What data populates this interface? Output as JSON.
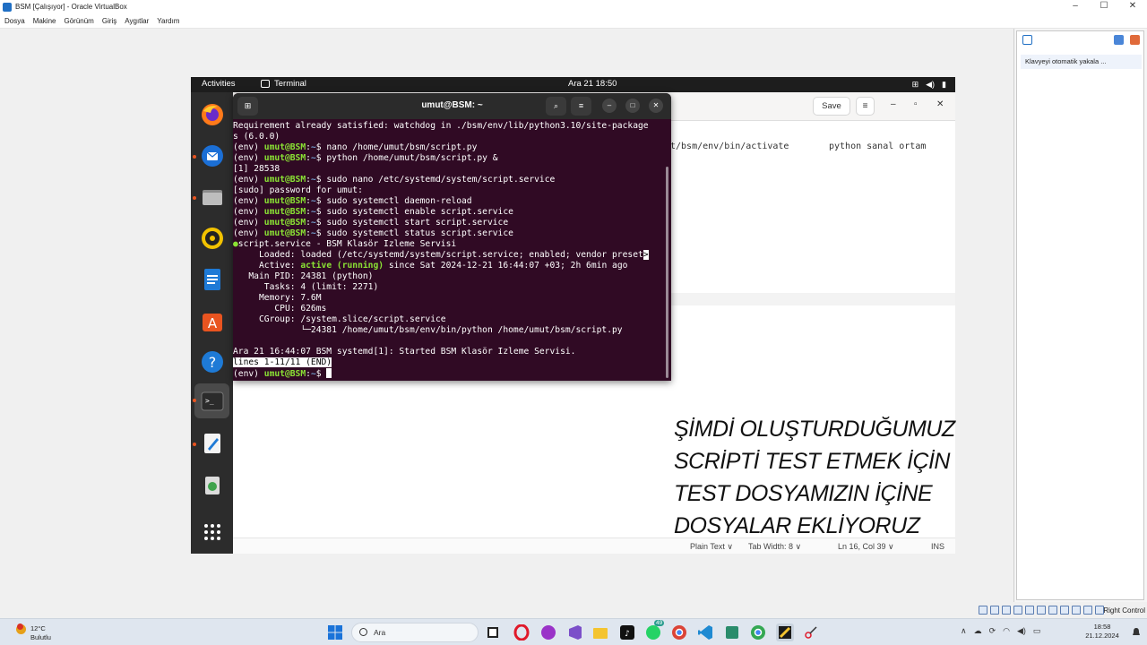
{
  "vbox": {
    "title": "BSM [Çalışıyor] - Oracle VirtualBox",
    "menu": [
      "Dosya",
      "Makine",
      "Görünüm",
      "Giriş",
      "Aygıtlar",
      "Yardım"
    ],
    "controls": {
      "minimize": "–",
      "maximize": "☐",
      "close": "✕"
    },
    "side_notice": "Klavyeyi otomatik yakala ...",
    "status_right": "Right Control"
  },
  "gnome": {
    "activities": "Activities",
    "app": "Terminal",
    "clock": "Ara 21  18:50",
    "tray": [
      "⊞",
      "◀)",
      "▮"
    ]
  },
  "dock": {
    "items": [
      "firefox-icon",
      "thunderbird-icon",
      "files-icon",
      "rhythmbox-icon",
      "writer-icon",
      "software-icon",
      "help-icon",
      "terminal-icon",
      "text-editor-icon",
      "trash-icon",
      "apps-grid-icon"
    ]
  },
  "editor": {
    "save": "Save",
    "menu": "≡",
    "win_min": "–",
    "win_max": "▫",
    "win_close": "✕",
    "line_text": "t/bsm/env/bin/activate",
    "line_comment": "python sanal ortam",
    "status": {
      "lang": "Plain Text ∨",
      "tab": "Tab Width: 8 ∨",
      "pos": "Ln 16, Col 39 ∨",
      "mode": "INS"
    }
  },
  "terminal": {
    "title": "umut@BSM: ~",
    "lines": {
      "l1": "Requirement already satisfied: watchdog in ./bsm/env/lib/python3.10/site-package",
      "l2": "s (6.0.0)",
      "p_env": "(env) ",
      "p_user": "umut@BSM",
      "p_sep": ":",
      "p_path": "~",
      "p_dollar": "$ ",
      "c3": "nano /home/umut/bsm/script.py",
      "c4": "python /home/umut/bsm/script.py &",
      "l5": "[1] 28538",
      "c6": "sudo nano /etc/systemd/system/script.service",
      "l7": "[sudo] password for umut:",
      "c8": "sudo systemctl daemon-reload",
      "c9": "sudo systemctl enable script.service",
      "c10": "sudo systemctl start script.service",
      "c11": "sudo systemctl status script.service",
      "s1_dot": "●",
      "s1": "script.service - BSM Klasör İzleme Servisi",
      "s2": "     Loaded: loaded (/etc/systemd/system/script.service; enabled; vendor preset",
      "s2_more": ">",
      "s3_pre": "     Active: ",
      "s3_status": "active (running)",
      "s3_post": " since Sat 2024-12-21 16:44:07 +03; 2h 6min ago",
      "s4": "   Main PID: 24381 (python)",
      "s5": "      Tasks: 4 (limit: 2271)",
      "s6": "     Memory: 7.6M",
      "s7": "        CPU: 626ms",
      "s8": "     CGroup: /system.slice/script.service",
      "s9": "             └─24381 /home/umut/bsm/env/bin/python /home/umut/bsm/script.py",
      "s11": "Ara 21 16:44:07 BSM systemd[1]: Started BSM Klasör İzleme Servisi.",
      "s12": "lines 1-11/11 (END)"
    }
  },
  "overlay": {
    "line1": "ŞİMDİ OLUŞTURDUĞUMUZ",
    "line2": "SCRİPTİ TEST ETMEK İÇİN",
    "line3": "TEST DOSYAMIZIN İÇİNE",
    "line4": "DOSYALAR EKLİYORUZ"
  },
  "taskbar": {
    "temp": "12°C",
    "condition": "Bulutlu",
    "search_placeholder": "Ara",
    "whatsapp_badge": "49",
    "time": "18:58",
    "date": "21.12.2024",
    "tray_chevron": "∧"
  }
}
